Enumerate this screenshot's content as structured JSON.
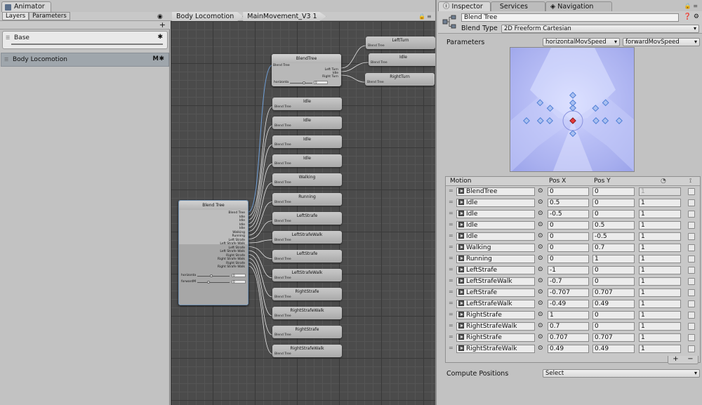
{
  "animator": {
    "title": "Animator",
    "tabs": [
      "Layers",
      "Parameters"
    ],
    "breadcrumbs": [
      "Body Locomotion",
      "MainMovement_V3 1"
    ],
    "add_symbol": "+",
    "layers": [
      {
        "name": "Base"
      },
      {
        "name": "Body Locomotion",
        "flag": "M"
      }
    ]
  },
  "graph": {
    "top_tree": {
      "title": "BlendTree",
      "input": "Blend Tree",
      "outputs": [
        "Left Turn",
        "Idle",
        "Right Turn"
      ],
      "param_label": "horizonta",
      "param_value": "0"
    },
    "turn_nodes": [
      {
        "title": "LeftTurn",
        "sub": "Blend Tree"
      },
      {
        "title": "Idle",
        "sub": "Blend Tree"
      },
      {
        "title": "RightTurn",
        "sub": "Blend Tree"
      }
    ],
    "motion_nodes": [
      {
        "title": "Idle",
        "sub": "Blend Tree"
      },
      {
        "title": "Idle",
        "sub": "Blend Tree"
      },
      {
        "title": "Idle",
        "sub": "Blend Tree"
      },
      {
        "title": "Idle",
        "sub": "Blend Tree"
      },
      {
        "title": "Walking",
        "sub": "Blend Tree"
      },
      {
        "title": "Running",
        "sub": "Blend Tree"
      },
      {
        "title": "LeftStrafe",
        "sub": "Blend Tree"
      },
      {
        "title": "LeftStrafeWalk",
        "sub": "Blend Tree"
      },
      {
        "title": "LeftStrafe",
        "sub": "Blend Tree"
      },
      {
        "title": "LeftStrafeWalk",
        "sub": "Blend Tree"
      },
      {
        "title": "RightStrafe",
        "sub": "Blend Tree"
      },
      {
        "title": "RightStrafeWalk",
        "sub": "Blend Tree"
      },
      {
        "title": "RightStrafe",
        "sub": "Blend Tree"
      },
      {
        "title": "RightStrafeWalk",
        "sub": "Blend Tree"
      }
    ],
    "main_tree": {
      "title": "Blend Tree",
      "outputs": [
        "Blend Tree",
        "Idle",
        "Idle",
        "Idle",
        "Idle",
        "Walking",
        "Running",
        "Left Strafe",
        "Left Strafe Walk",
        "Left Strafe",
        "Left Strafe Walk",
        "Right Strafe",
        "Right Strafe Walk",
        "Right Strafe",
        "Right Strafe Walk"
      ],
      "params": [
        {
          "label": "horizonta",
          "value": "0"
        },
        {
          "label": "forwardM",
          "value": "0"
        }
      ]
    }
  },
  "inspector": {
    "tabs": [
      "Inspector",
      "Services",
      "Navigation"
    ],
    "object_name": "Blend Tree",
    "blend_type_label": "Blend Type",
    "blend_type": "2D Freeform Cartesian",
    "parameters_label": "Parameters",
    "param_x": "horizontalMovSpeed",
    "param_y": "forwardMovSpeed",
    "columns": {
      "motion": "Motion",
      "posx": "Pos X",
      "posy": "Pos Y"
    },
    "motions": [
      {
        "name": "BlendTree",
        "x": "0",
        "y": "0",
        "t": "1",
        "blendtree": true
      },
      {
        "name": "Idle",
        "x": "0.5",
        "y": "0",
        "t": "1"
      },
      {
        "name": "Idle",
        "x": "-0.5",
        "y": "0",
        "t": "1"
      },
      {
        "name": "Idle",
        "x": "0",
        "y": "0.5",
        "t": "1"
      },
      {
        "name": "Idle",
        "x": "0",
        "y": "-0.5",
        "t": "1"
      },
      {
        "name": "Walking",
        "x": "0",
        "y": "0.7",
        "t": "1"
      },
      {
        "name": "Running",
        "x": "0",
        "y": "1",
        "t": "1"
      },
      {
        "name": "LeftStrafe",
        "x": "-1",
        "y": "0",
        "t": "1"
      },
      {
        "name": "LeftStrafeWalk",
        "x": "-0.7",
        "y": "0",
        "t": "1"
      },
      {
        "name": "LeftStrafe",
        "x": "-0.707",
        "y": "0.707",
        "t": "1"
      },
      {
        "name": "LeftStrafeWalk",
        "x": "-0.49",
        "y": "0.49",
        "t": "1"
      },
      {
        "name": "RightStrafe",
        "x": "1",
        "y": "0",
        "t": "1"
      },
      {
        "name": "RightStrafeWalk",
        "x": "0.7",
        "y": "0",
        "t": "1"
      },
      {
        "name": "RightStrafe",
        "x": "0.707",
        "y": "0.707",
        "t": "1"
      },
      {
        "name": "RightStrafeWalk",
        "x": "0.49",
        "y": "0.49",
        "t": "1"
      }
    ],
    "list_buttons": {
      "add": "+",
      "remove": "−"
    },
    "compute_label": "Compute Positions",
    "compute_value": "Select"
  },
  "colors": {
    "blend_point": "#4f7fd6",
    "current_point": "#e23a3a",
    "graph_bg": "#4b4b4b",
    "selection": "#6e8fb0"
  }
}
